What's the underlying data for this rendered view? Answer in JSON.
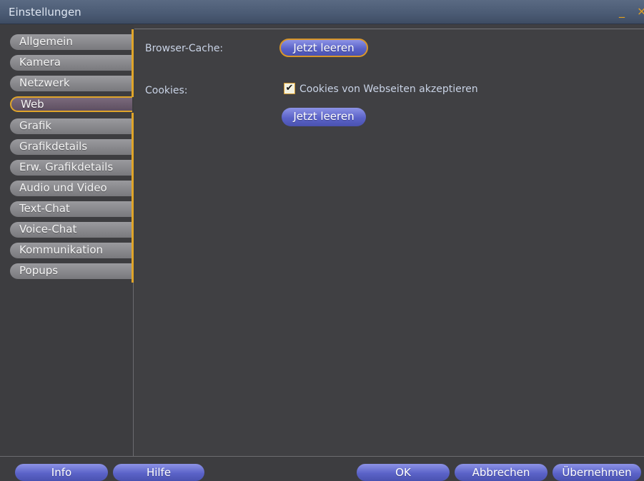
{
  "window": {
    "title": "Einstellungen",
    "minimize": "_",
    "close": "×"
  },
  "sidebar": {
    "tabs": [
      {
        "label": "Allgemein"
      },
      {
        "label": "Kamera"
      },
      {
        "label": "Netzwerk"
      },
      {
        "label": "Web",
        "selected": true
      },
      {
        "label": "Grafik"
      },
      {
        "label": "Grafikdetails"
      },
      {
        "label": "Erw. Grafikdetails"
      },
      {
        "label": "Audio und Video"
      },
      {
        "label": "Text-Chat"
      },
      {
        "label": "Voice-Chat"
      },
      {
        "label": "Kommunikation"
      },
      {
        "label": "Popups"
      }
    ]
  },
  "web": {
    "browser_cache_label": "Browser-Cache:",
    "browser_cache_button": "Jetzt leeren",
    "cookies_label": "Cookies:",
    "cookies_checkbox_label": "Cookies von Webseiten akzeptieren",
    "cookies_checked": true,
    "cookies_button": "Jetzt leeren"
  },
  "footer": {
    "info": "Info",
    "hilfe": "Hilfe",
    "ok": "OK",
    "abbrechen": "Abbrechen",
    "uebernehmen": "Übernehmen"
  },
  "colors": {
    "accent_orange": "#e0a52a",
    "button_blue": "#5b63c8",
    "background": "#404043"
  }
}
